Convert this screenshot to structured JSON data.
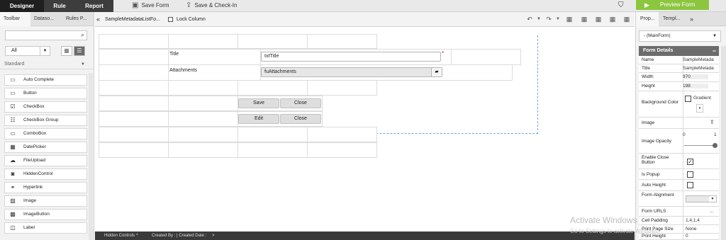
{
  "topbar": {
    "tabs": [
      "Designer",
      "Rule",
      "Report"
    ],
    "save_form": "Save Form",
    "save_checkin": "Save & Check-In",
    "preview_form": "Preview Form"
  },
  "left": {
    "tabs": [
      "Toolbar",
      "Datasо...",
      "Rules P..."
    ],
    "filter_value": "All",
    "section": "Standard",
    "controls": [
      "Auto Complete",
      "Button",
      "CheckBox",
      "CheckBox Group",
      "ComboBox",
      "DatePicker",
      "FileUpload",
      "HiddenControl",
      "Hyperlink",
      "Image",
      "ImageButton",
      "Label"
    ]
  },
  "canvas": {
    "form_name": "SampleMetadataListFo...",
    "lock_column": "Lock Column",
    "title_label": "Title",
    "title_value": "txtTitle",
    "attach_label": "Attachments",
    "attach_value": "fuAttachments",
    "buttons": {
      "save": "Save",
      "close1": "Close",
      "edit": "Edit",
      "close2": "Close"
    }
  },
  "bottombar": {
    "hidden_controls": "Hidden Controls",
    "created": "Created By : | Created Date :"
  },
  "right": {
    "tabs": [
      "Prop...",
      "Templ..."
    ],
    "mainform": "- (MainForm)",
    "section": "Form Details",
    "props": {
      "name_k": "Name",
      "name_v": "SampleMetada",
      "title_k": "Title",
      "title_v": "SampleMetada",
      "width_k": "Width",
      "width_v": "970",
      "height_k": "Height",
      "height_v": "198",
      "bg_k": "Background Color",
      "gradient": "Gradient",
      "image_k": "Image",
      "opacity_k": "Image Opacity",
      "opacity_min": "0",
      "opacity_max": "1",
      "close_k": "Enable Close Button",
      "popup_k": "Is Popup",
      "autoh_k": "Auto Height",
      "align_k": "Form Alignment",
      "urls_k": "Form URLS",
      "urls_v": "...",
      "cellpad_k": "Cell Padding",
      "cellpad_v": "1,4,1,4",
      "print_k": "Print Page Size",
      "print_v": "None",
      "printh_k": "Print Height",
      "printh_v": "0"
    }
  },
  "watermark": {
    "line1": "Activate Windows",
    "line2": "Go to Settings to activate Windows."
  }
}
